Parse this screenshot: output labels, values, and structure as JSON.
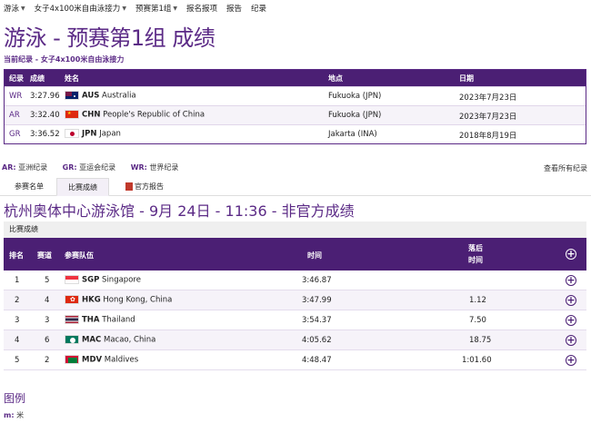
{
  "nav": [
    {
      "label": "游泳",
      "caret": true
    },
    {
      "label": "女子4x100米自由泳接力",
      "caret": true
    },
    {
      "label": "预赛第1组",
      "caret": true
    },
    {
      "label": "报名报项",
      "caret": false
    },
    {
      "label": "报告",
      "caret": false
    },
    {
      "label": "纪录",
      "caret": false
    }
  ],
  "page_title": "游泳 - 预赛第1组 成绩",
  "subtitle": "当前纪录 - 女子4x100米自由泳接力",
  "records": {
    "headers": {
      "record": "纪录",
      "result": "成绩",
      "name": "姓名",
      "venue": "地点",
      "date": "日期"
    },
    "rows": [
      {
        "record": "WR",
        "result": "3:27.96",
        "flag": "AUS",
        "code": "AUS",
        "country": "Australia",
        "venue": "Fukuoka (JPN)",
        "date": "2023年7月23日"
      },
      {
        "record": "AR",
        "result": "3:32.40",
        "flag": "CHN",
        "code": "CHN",
        "country": "People's Republic of China",
        "venue": "Fukuoka (JPN)",
        "date": "2023年7月23日"
      },
      {
        "record": "GR",
        "result": "3:36.52",
        "flag": "JPN",
        "code": "JPN",
        "country": "Japan",
        "venue": "Jakarta (INA)",
        "date": "2018年8月19日"
      }
    ]
  },
  "abbreviations": [
    {
      "code": "AR:",
      "text": "亚洲纪录"
    },
    {
      "code": "GR:",
      "text": "亚运会纪录"
    },
    {
      "code": "WR:",
      "text": "世界纪录"
    }
  ],
  "all_records_link": "查看所有纪录",
  "tabs": [
    {
      "label": "参赛名单",
      "active": false
    },
    {
      "label": "比赛成绩",
      "active": true
    },
    {
      "label": "官方报告",
      "active": false
    }
  ],
  "event_title": "杭州奥体中心游泳馆 - 9月 24日 - 11:36 - 非官方成绩",
  "section_label": "比赛成绩",
  "results": {
    "headers": {
      "rank": "排名",
      "lane": "赛道",
      "team": "参赛队伍",
      "time": "时间",
      "behind_1": "落后",
      "behind_2": "时间"
    },
    "rows": [
      {
        "rank": "1",
        "lane": "5",
        "flag": "SGP",
        "code": "SGP",
        "country": "Singapore",
        "time": "3:46.87",
        "behind": ""
      },
      {
        "rank": "2",
        "lane": "4",
        "flag": "HKG",
        "code": "HKG",
        "country": "Hong Kong, China",
        "time": "3:47.99",
        "behind": "1.12"
      },
      {
        "rank": "3",
        "lane": "3",
        "flag": "THA",
        "code": "THA",
        "country": "Thailand",
        "time": "3:54.37",
        "behind": "7.50"
      },
      {
        "rank": "4",
        "lane": "6",
        "flag": "MAC",
        "code": "MAC",
        "country": "Macao, China",
        "time": "4:05.62",
        "behind": "18.75"
      },
      {
        "rank": "5",
        "lane": "2",
        "flag": "MDV",
        "code": "MDV",
        "country": "Maldives",
        "time": "4:48.47",
        "behind": "1:01.60"
      }
    ]
  },
  "legend": {
    "title": "图例",
    "items": [
      {
        "code": "m:",
        "text": "米"
      }
    ]
  },
  "colors": {
    "brand": "#4b1f74",
    "accent": "#5b2a86"
  }
}
